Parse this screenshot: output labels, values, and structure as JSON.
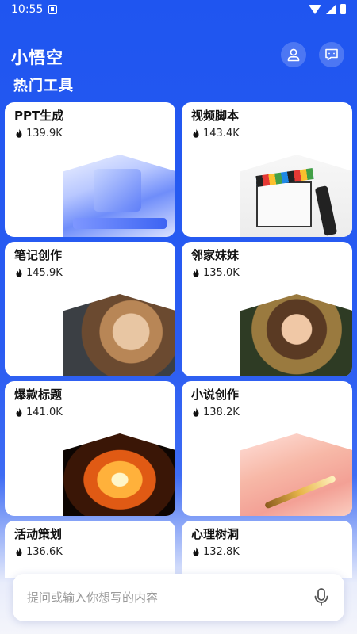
{
  "status": {
    "time": "10:55"
  },
  "header": {
    "title": "小悟空",
    "section": "热门工具"
  },
  "tools": [
    {
      "name": "PPT生成",
      "count": "139.9K",
      "thumb": "ppt-3d-illustration"
    },
    {
      "name": "视频脚本",
      "count": "143.4K",
      "thumb": "clapperboard-photo"
    },
    {
      "name": "笔记创作",
      "count": "145.9K",
      "thumb": "woman-portrait-photo"
    },
    {
      "name": "邻家妹妹",
      "count": "135.0K",
      "thumb": "laughing-woman-photo"
    },
    {
      "name": "爆款标题",
      "count": "141.0K",
      "thumb": "fire-explosion-photo"
    },
    {
      "name": "小说创作",
      "count": "138.2K",
      "thumb": "letter-quill-photo"
    },
    {
      "name": "活动策划",
      "count": "136.6K",
      "thumb": ""
    },
    {
      "name": "心理树洞",
      "count": "132.8K",
      "thumb": ""
    }
  ],
  "input": {
    "placeholder": "提问或输入你想写的内容"
  },
  "colors": {
    "primary": "#2a5cf2",
    "fire_icon": "#111111"
  }
}
